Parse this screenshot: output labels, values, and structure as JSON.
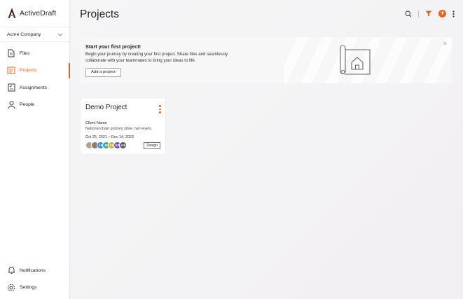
{
  "app": {
    "name": "ActiveDraft"
  },
  "sidebar": {
    "company": "Acme Company",
    "items": [
      {
        "label": "Files",
        "icon": "file-icon",
        "active": false
      },
      {
        "label": "Projects",
        "icon": "projects-icon",
        "active": true
      },
      {
        "label": "Assignments",
        "icon": "assignments-icon",
        "active": false
      },
      {
        "label": "People",
        "icon": "person-icon",
        "active": false
      }
    ],
    "bottom_items": [
      {
        "label": "Notifications",
        "icon": "bell-icon"
      },
      {
        "label": "Settings",
        "icon": "gear-icon"
      }
    ]
  },
  "header": {
    "title": "Projects",
    "icons": [
      "search-icon",
      "filter-icon",
      "add-icon",
      "more-vertical-icon"
    ]
  },
  "banner": {
    "title": "Start your first project!",
    "text": "Begin your journey by creating your first project. Share files and seamlessly collaborate with your teammates to bring your ideas to life.",
    "button": "Add a project",
    "close": "×"
  },
  "project_card": {
    "title": "Demo Project",
    "client_label": "Client Name",
    "description": "National chain grocery store, two levels.",
    "dates": "Oct 25, 2021 – Dec 14, 2023",
    "tag": "Design",
    "avatars": [
      {
        "initials": "",
        "color": "#b7a38f"
      },
      {
        "initials": "",
        "color": "#8c7a6b"
      },
      {
        "initials": "AF",
        "color": "#3d8bd6"
      },
      {
        "initials": "JN",
        "color": "#39a3a8"
      },
      {
        "initials": "CL",
        "color": "#c9b23a"
      },
      {
        "initials": "KP",
        "color": "#7d4fb0"
      },
      {
        "initials": "+25",
        "color": "#5a5a66"
      }
    ]
  },
  "colors": {
    "accent": "#e8631e"
  }
}
